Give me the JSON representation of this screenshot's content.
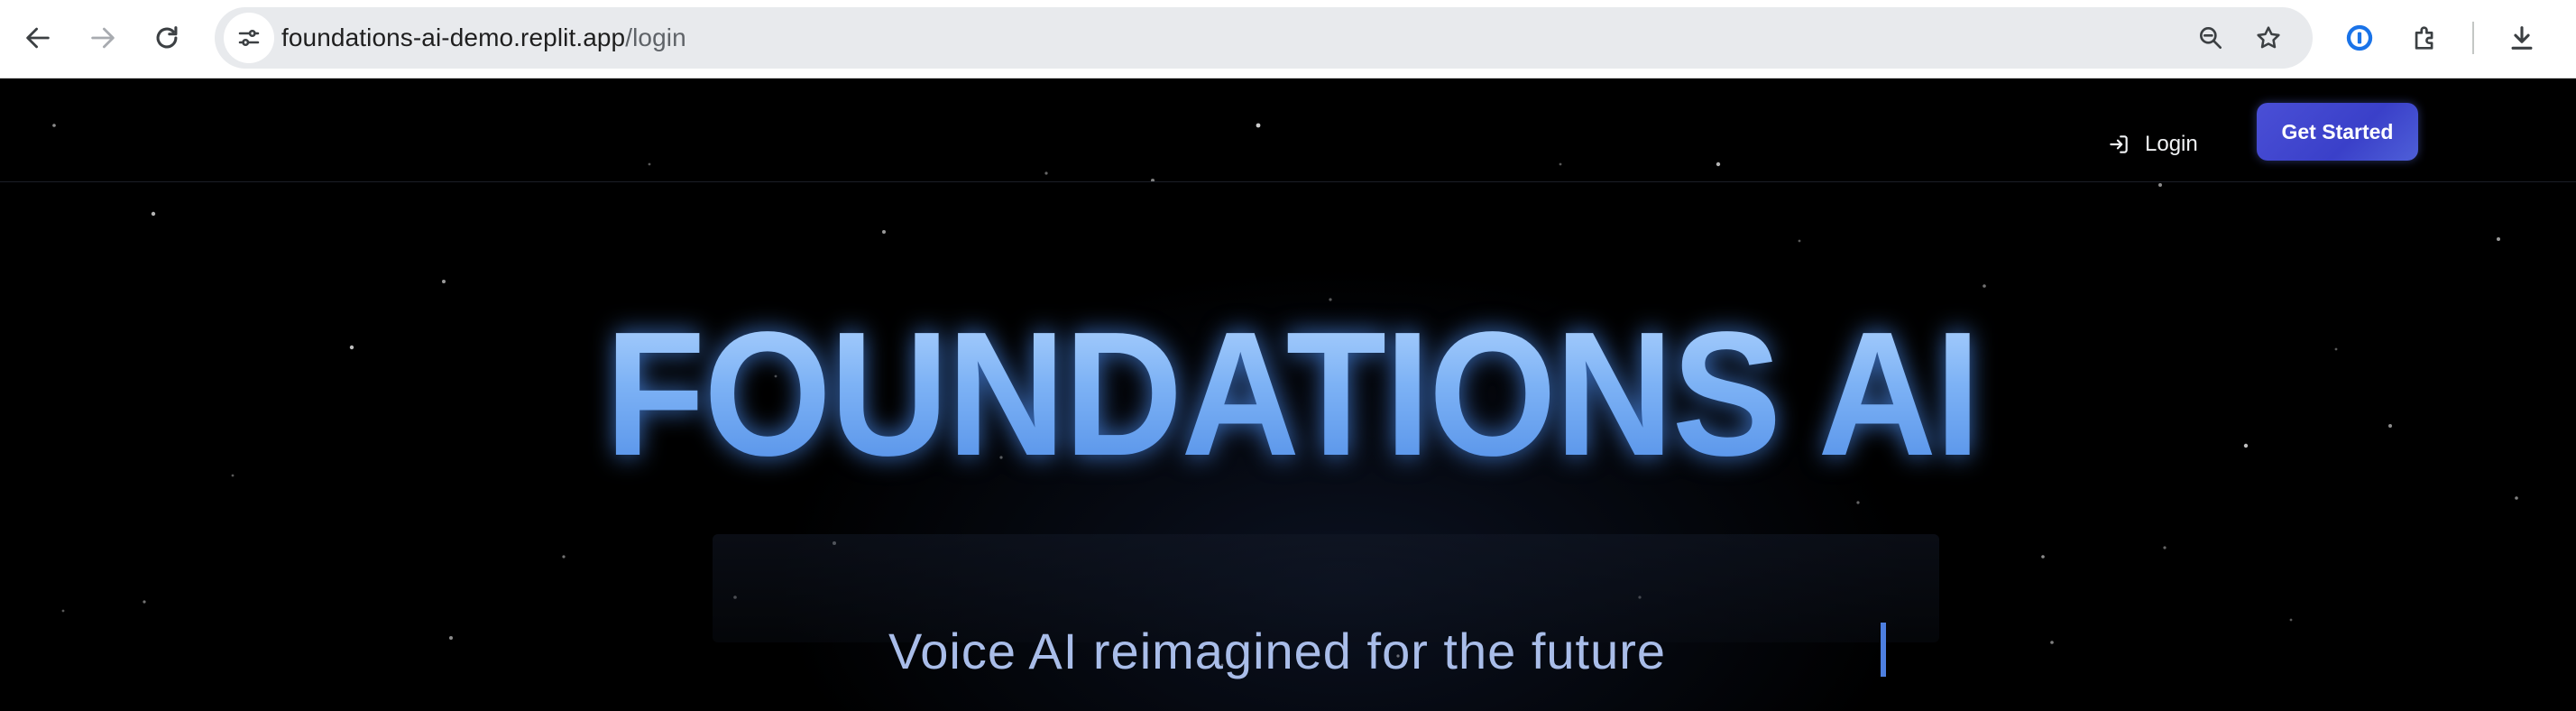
{
  "browser": {
    "url_host": "foundations-ai-demo.replit.app",
    "url_path": "/login"
  },
  "nav": {
    "login_label": "Login",
    "cta_label": "Get Started"
  },
  "hero": {
    "title": "FOUNDATIONS AI",
    "tagline": "Voice AI reimagined for the future"
  },
  "colors": {
    "accent": "#3f46d0",
    "title_blue": "#7db2f5",
    "tagline": "#a9bde9",
    "background": "#000000"
  },
  "icons": [
    "back-icon",
    "forward-icon",
    "reload-icon",
    "site-info-icon",
    "zoom-icon",
    "bookmark-star-icon",
    "password-manager-icon",
    "extensions-icon",
    "download-icon",
    "login-icon"
  ]
}
